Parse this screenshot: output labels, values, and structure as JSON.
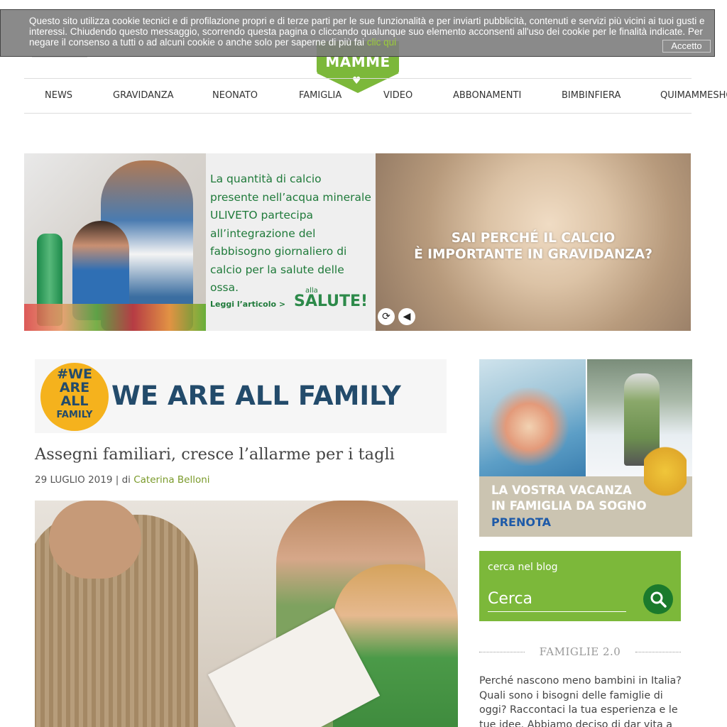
{
  "cookie": {
    "text": "Questo sito utilizza cookie tecnici e di profilazione propri e di terze parti per le sue funzionalità e per inviarti pubblicità, contenuti e servizi più vicini ai tuoi gusti e interessi. Chiudendo questo messaggio, scorrendo questa pagina o cliccando qualunque suo elemento acconsenti all'uso dei cookie per le finalità indicate. Per negare il consenso a tutti o ad alcuni cookie o anche solo per saperne di più fai",
    "link": "clic qui",
    "accept": "Accetto"
  },
  "logo": {
    "text": "MAMME",
    "heart": "♥"
  },
  "nav": {
    "items": [
      "NEWS",
      "GRAVIDANZA",
      "NEONATO",
      "FAMIGLIA",
      "VIDEO",
      "ABBONAMENTI",
      "BIMBINFIERA",
      "QUIMAMMESHO"
    ]
  },
  "ad_banner": {
    "body": "La quantità di calcio presente nell’acqua minerale ULIVETO partecipa all’integrazione del fabbisogno giornaliero di calcio per la salute delle ossa.",
    "read_more": "Leggi l’articolo >",
    "brand_small": "alla",
    "brand": "SALUTE!",
    "headline_1": "SAI PERCHÉ IL CALCIO",
    "headline_2": "È IMPORTANTE IN GRAVIDANZA?",
    "replay_icon": "⟳",
    "audio_icon": "◀"
  },
  "family_banner": {
    "circle_lines": [
      "#WE",
      "ARE",
      "ALL",
      "FAMILY"
    ],
    "title": "WE ARE ALL FAMILY"
  },
  "article": {
    "title": "Assegni familiari, cresce l’allarme per i tagli",
    "date": "29 LUGLIO 2019",
    "separator": "| di",
    "author": "Caterina Belloni"
  },
  "sidebar": {
    "ad_line_1": "LA VOSTRA VACANZA",
    "ad_line_2": "IN FAMIGLIA DA SOGNO",
    "ad_cta": "PRENOTA",
    "search_label": "cerca nel blog",
    "search_placeholder": "Cerca",
    "section_title": "FAMIGLIE 2.0",
    "paragraph": "Perché nascono meno bambini in Italia? Quali sono i bisogni delle famiglie di oggi? Raccontaci la tua esperienza e le tue idee. Abbiamo deciso di dar vita a uno spazio"
  },
  "colors": {
    "brand_green": "#7cb83a",
    "dark_green": "#1b7a2c",
    "navy": "#234b6b",
    "family_yellow": "#f5b21d"
  }
}
